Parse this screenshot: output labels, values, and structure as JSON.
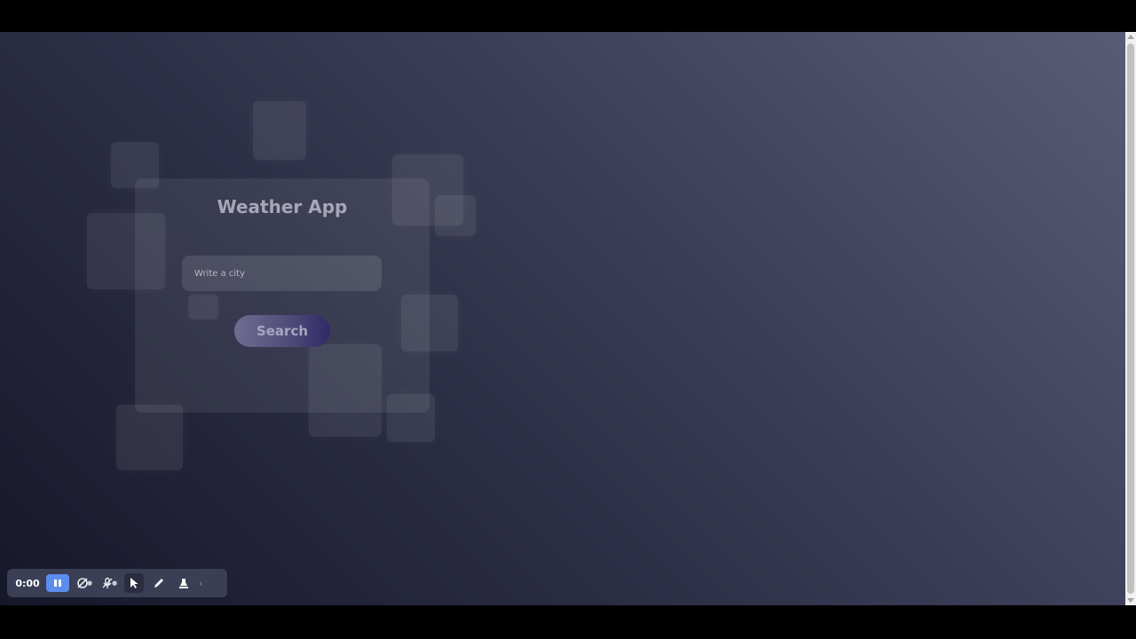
{
  "app": {
    "title": "Weather App",
    "city_input_placeholder": "Write a city",
    "search_label": "Search"
  },
  "recorder": {
    "timer": "0:00",
    "pause_icon": "pause-icon",
    "camera_icon": "camera-off-icon",
    "mic_icon": "mic-off-icon",
    "pointer_icon": "cursor-icon",
    "pen_icon": "pen-icon",
    "highlighter_icon": "highlighter-icon",
    "collapse_icon": "chevron-left-icon",
    "accent_color": "#5b8dee"
  },
  "colors": {
    "background_dark": "#17172a",
    "background_light": "#595c75",
    "button_gradient_end": "#2f2a66"
  }
}
